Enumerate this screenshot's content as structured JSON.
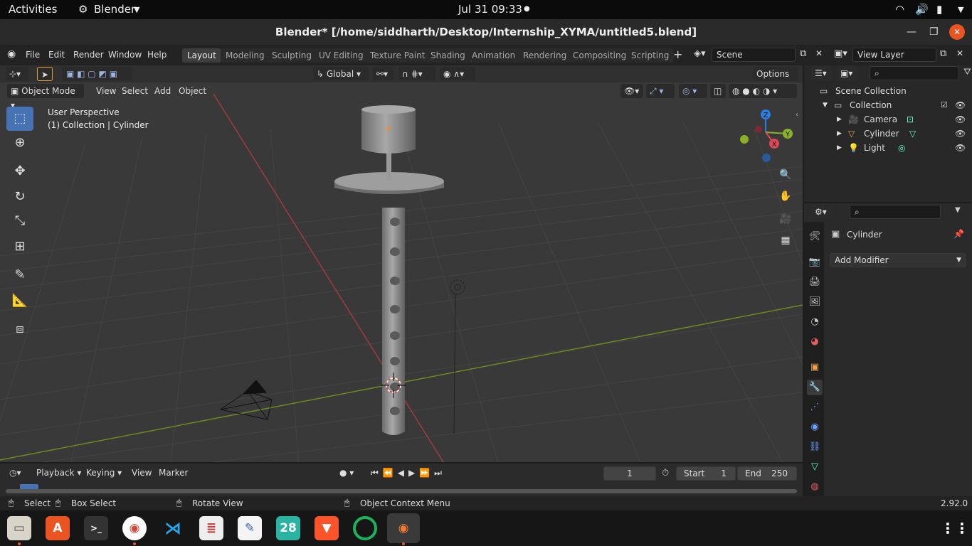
{
  "gnome": {
    "activities": "Activities",
    "app": "Blender",
    "datetime": "Jul 31  09:33"
  },
  "window": {
    "title": "Blender* [/home/siddharth/Desktop/Internship_XYMA/untitled5.blend]"
  },
  "menu": {
    "items": [
      "File",
      "Edit",
      "Render",
      "Window",
      "Help"
    ]
  },
  "workspaces": [
    "Layout",
    "Modeling",
    "Sculpting",
    "UV Editing",
    "Texture Paint",
    "Shading",
    "Animation",
    "Rendering",
    "Compositing",
    "Scripting"
  ],
  "active_workspace": "Layout",
  "scene": {
    "label": "Scene"
  },
  "view_layer": {
    "label": "View Layer"
  },
  "viewport": {
    "transform_orientation": "Global",
    "options_label": "Options",
    "mode": "Object Mode",
    "menus": [
      "View",
      "Select",
      "Add",
      "Object"
    ],
    "perspective_label": "User Perspective",
    "collection_label": "(1) Collection | Cylinder",
    "gizmo": {
      "z": "Z",
      "y": "Y",
      "x": "X"
    }
  },
  "outliner": {
    "scene_collection": "Scene Collection",
    "collection": "Collection",
    "objects": [
      "Camera",
      "Cylinder",
      "Light"
    ]
  },
  "properties": {
    "object_name": "Cylinder",
    "add_modifier": "Add Modifier"
  },
  "timeline": {
    "menus": [
      "Playback",
      "Keying",
      "View",
      "Marker"
    ],
    "current_frame": "1",
    "start_label": "Start",
    "start_value": "1",
    "end_label": "End",
    "end_value": "250"
  },
  "status": {
    "select": "Select",
    "box_select": "Box Select",
    "rotate_view": "Rotate View",
    "context_menu": "Object Context Menu",
    "version": "2.92.0"
  },
  "dock": {
    "calendar_day": "28"
  },
  "colors": {
    "accent": "#4772b3",
    "x_axis": "#e0485a",
    "y_axis": "#8bb226",
    "z_axis": "#2a7de1",
    "dock_indicator": "#e95420"
  }
}
